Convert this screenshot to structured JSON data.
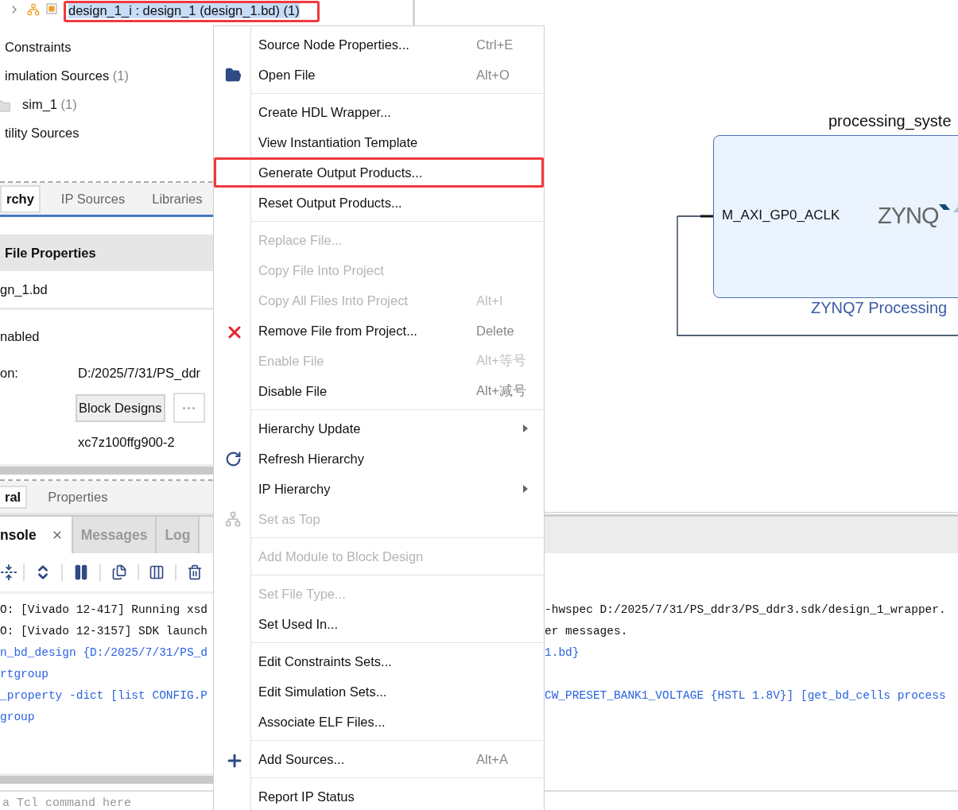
{
  "sources_tree": {
    "items": [
      {
        "label": "design_1_i : design_1 (design_1.bd) (1)",
        "selected": true,
        "annotated": true
      },
      {
        "label": "Constraints",
        "selected": false,
        "annotated": false
      },
      {
        "label": "imulation Sources",
        "count": "(1)",
        "selected": false,
        "annotated": false
      },
      {
        "label": "sim_1",
        "count": "(1)",
        "selected": false,
        "annotated": false
      },
      {
        "label": "tility Sources",
        "selected": false,
        "annotated": false
      }
    ]
  },
  "source_tabs": [
    {
      "label": "rchy",
      "selected": true
    },
    {
      "label": "IP Sources",
      "selected": false
    },
    {
      "label": "Libraries",
      "selected": false
    }
  ],
  "file_properties": {
    "title": "File Properties",
    "file_name": "gn_1.bd",
    "status": "nabled",
    "location_label": "on:",
    "location_value": "D:/2025/7/31/PS_ddr",
    "type_button": "Block Designs",
    "part": "xc7z100ffg900-2"
  },
  "property_tabs": [
    {
      "label": "ral",
      "selected": true
    },
    {
      "label": "Properties",
      "selected": false
    }
  ],
  "diagram": {
    "block_title": "processing_syste",
    "pin": "M_AXI_GP0_ACLK",
    "logo": "ZYNQ",
    "block_caption": "ZYNQ7 Processing"
  },
  "console": {
    "tabs": [
      {
        "label": "nsole",
        "selected": true
      },
      {
        "label": "Messages",
        "selected": false
      },
      {
        "label": "Log",
        "selected": false
      }
    ],
    "lines": [
      {
        "kind": "output",
        "left": "O: [Vivado 12-417] Running xsd",
        "right": "-hwspec D:/2025/7/31/PS_ddr3/PS_ddr3.sdk/design_1_wrapper."
      },
      {
        "kind": "output",
        "left": "O: [Vivado 12-3157] SDK launch",
        "right": "er messages."
      },
      {
        "kind": "command",
        "left": "n_bd_design {D:/2025/7/31/PS_d",
        "right": "1.bd}"
      },
      {
        "kind": "command",
        "left": "rtgroup"
      },
      {
        "kind": "command",
        "left": "_property -dict [list CONFIG.P",
        "right": "CW_PRESET_BANK1_VOLTAGE {HSTL 1.8V}] [get_bd_cells process"
      },
      {
        "kind": "command",
        "left": "group"
      }
    ],
    "input_placeholder": "a Tcl command here"
  },
  "context_menu": {
    "groups": [
      [
        {
          "label": "Source Node Properties...",
          "shortcut": "Ctrl+E",
          "disabled": false,
          "submenu": false,
          "annotated": false
        },
        {
          "label": "Open File",
          "shortcut": "Alt+O",
          "disabled": false,
          "submenu": false,
          "annotated": false
        }
      ],
      [
        {
          "label": "Create HDL Wrapper...",
          "disabled": false,
          "submenu": false,
          "annotated": false
        },
        {
          "label": "View Instantiation Template",
          "disabled": false,
          "submenu": false,
          "annotated": false
        },
        {
          "label": "Generate Output Products...",
          "disabled": false,
          "submenu": false,
          "annotated": true
        },
        {
          "label": "Reset Output Products...",
          "disabled": false,
          "submenu": false,
          "annotated": false
        }
      ],
      [
        {
          "label": "Replace File...",
          "disabled": true,
          "submenu": false,
          "annotated": false
        },
        {
          "label": "Copy File Into Project",
          "disabled": true,
          "submenu": false,
          "annotated": false
        },
        {
          "label": "Copy All Files Into Project",
          "shortcut": "Alt+I",
          "disabled": true,
          "submenu": false,
          "annotated": false
        },
        {
          "label": "Remove File from Project...",
          "shortcut": "Delete",
          "disabled": false,
          "submenu": false,
          "annotated": false
        },
        {
          "label": "Enable File",
          "shortcut": "Alt+等号",
          "disabled": true,
          "submenu": false,
          "annotated": false
        },
        {
          "label": "Disable File",
          "shortcut": "Alt+减号",
          "disabled": false,
          "submenu": false,
          "annotated": false
        }
      ],
      [
        {
          "label": "Hierarchy Update",
          "disabled": false,
          "submenu": true,
          "annotated": false
        },
        {
          "label": "Refresh Hierarchy",
          "disabled": false,
          "submenu": false,
          "annotated": false
        },
        {
          "label": "IP Hierarchy",
          "disabled": false,
          "submenu": true,
          "annotated": false
        },
        {
          "label": "Set as Top",
          "disabled": true,
          "submenu": false,
          "annotated": false
        }
      ],
      [
        {
          "label": "Add Module to Block Design",
          "disabled": true,
          "submenu": false,
          "annotated": false
        }
      ],
      [
        {
          "label": "Set File Type...",
          "disabled": true,
          "submenu": false,
          "annotated": false
        },
        {
          "label": "Set Used In...",
          "disabled": false,
          "submenu": false,
          "annotated": false
        }
      ],
      [
        {
          "label": "Edit Constraints Sets...",
          "disabled": false,
          "submenu": false,
          "annotated": false
        },
        {
          "label": "Edit Simulation Sets...",
          "disabled": false,
          "submenu": false,
          "annotated": false
        },
        {
          "label": "Associate ELF Files...",
          "disabled": false,
          "submenu": false,
          "annotated": false
        }
      ],
      [
        {
          "label": "Add Sources...",
          "shortcut": "Alt+A",
          "disabled": false,
          "submenu": false,
          "annotated": false
        }
      ],
      [
        {
          "label": "Report IP Status",
          "disabled": false,
          "submenu": false,
          "annotated": false
        }
      ]
    ]
  }
}
